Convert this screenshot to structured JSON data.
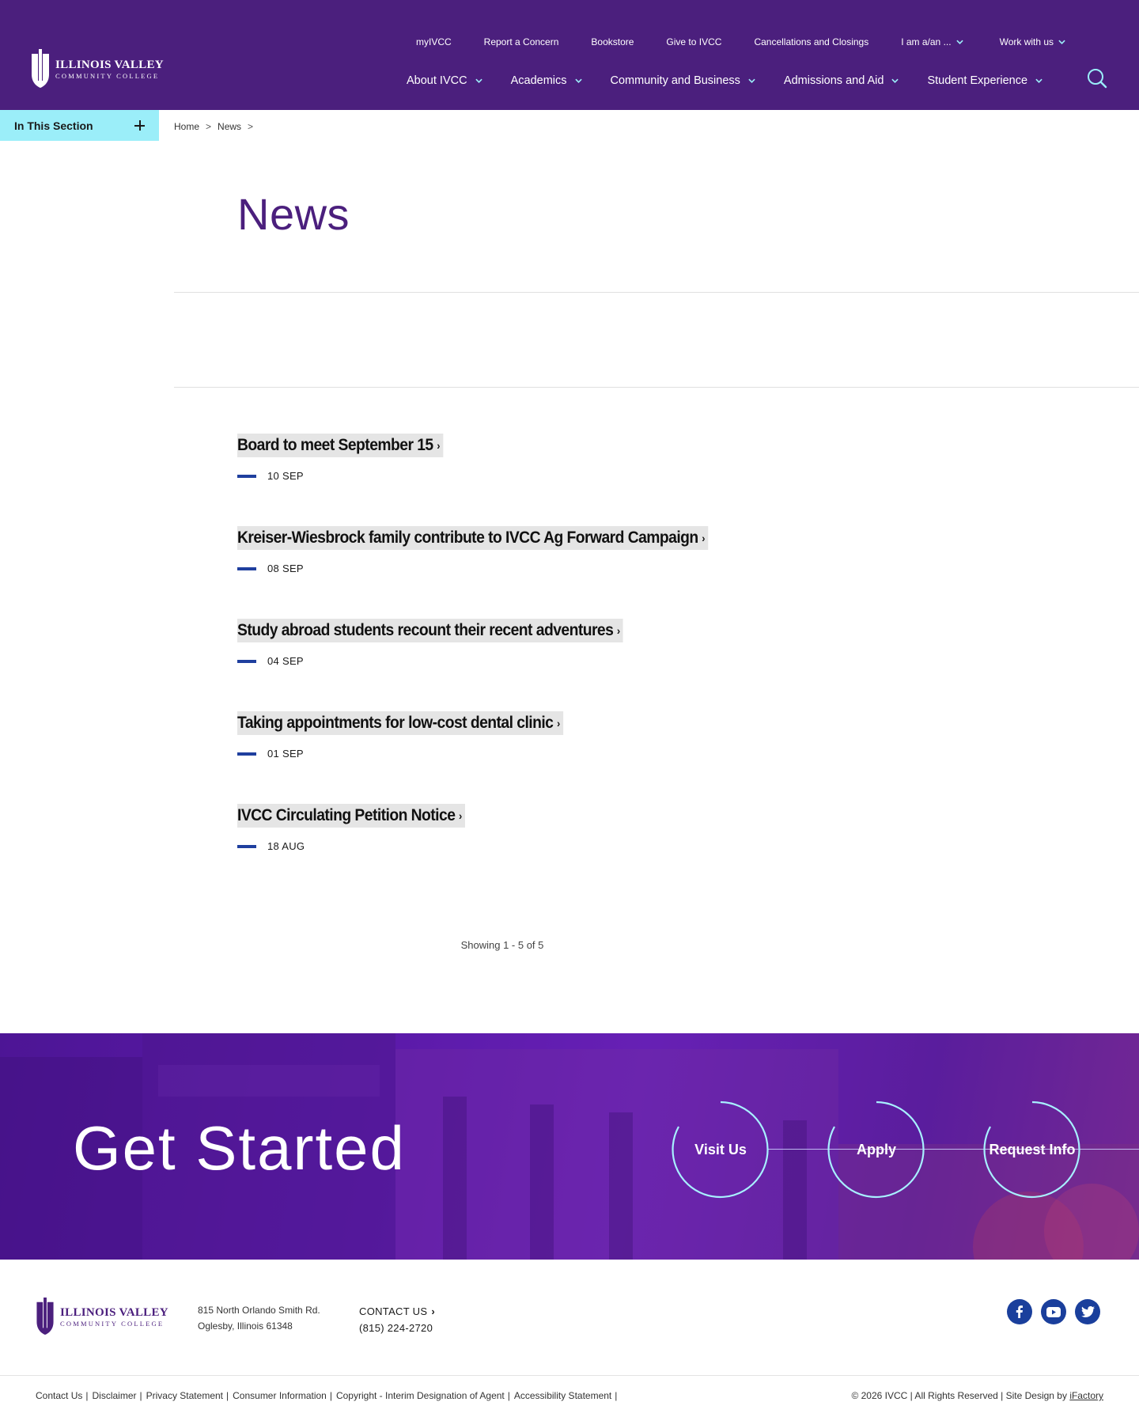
{
  "header": {
    "logo": {
      "line1": "ILLINOIS VALLEY",
      "line2": "COMMUNITY COLLEGE"
    },
    "utility_nav": [
      {
        "label": "myIVCC",
        "dropdown": false
      },
      {
        "label": "Report a Concern",
        "dropdown": false
      },
      {
        "label": "Bookstore",
        "dropdown": false
      },
      {
        "label": "Give to IVCC",
        "dropdown": false
      },
      {
        "label": "Cancellations and Closings",
        "dropdown": false
      },
      {
        "label": "I am a/an ...",
        "dropdown": true
      },
      {
        "label": "Work with us",
        "dropdown": true
      }
    ],
    "main_nav": [
      {
        "label": "About IVCC"
      },
      {
        "label": "Academics"
      },
      {
        "label": "Community and Business"
      },
      {
        "label": "Admissions and Aid"
      },
      {
        "label": "Student Experience"
      }
    ],
    "search_icon": "search-icon"
  },
  "section_toggle": {
    "label": "In This Section"
  },
  "breadcrumb": [
    "Home",
    "News"
  ],
  "page": {
    "title": "News"
  },
  "news": [
    {
      "title": "Board to meet September 15",
      "date": "10 SEP"
    },
    {
      "title": "Kreiser-Wiesbrock family contribute to IVCC Ag Forward Campaign",
      "date": "08 SEP"
    },
    {
      "title": "Study abroad students recount their recent adventures",
      "date": "04 SEP"
    },
    {
      "title": "Taking appointments for low-cost dental clinic",
      "date": "01 SEP"
    },
    {
      "title": "IVCC Circulating Petition Notice",
      "date": "18 AUG"
    }
  ],
  "pagination": {
    "info": "Showing 1 - 5 of 5"
  },
  "cta": {
    "title": "Get Started",
    "buttons": [
      "Visit Us",
      "Apply",
      "Request Info"
    ]
  },
  "footer": {
    "logo": {
      "line1": "ILLINOIS VALLEY",
      "line2": "COMMUNITY COLLEGE"
    },
    "address_line1": "815 North Orlando Smith Rd.",
    "address_line2": "Oglesby, Illinois 61348",
    "contact_label": "CONTACT US",
    "phone": "(815) 224-2720",
    "social": [
      "facebook-icon",
      "youtube-icon",
      "twitter-icon"
    ],
    "legal_links": [
      "Contact Us",
      "Disclaimer",
      "Privacy Statement",
      "Consumer Information",
      "Copyright - Interim Designation of Agent",
      "Accessibility Statement"
    ],
    "copyright_prefix": "© 2026 IVCC | All Rights Reserved | Site Design by",
    "design_credit": "iFactory"
  },
  "colors": {
    "brand_purple": "#4b1f7d",
    "accent_cyan": "#9beef9",
    "accent_blue": "#1f3f9e"
  }
}
